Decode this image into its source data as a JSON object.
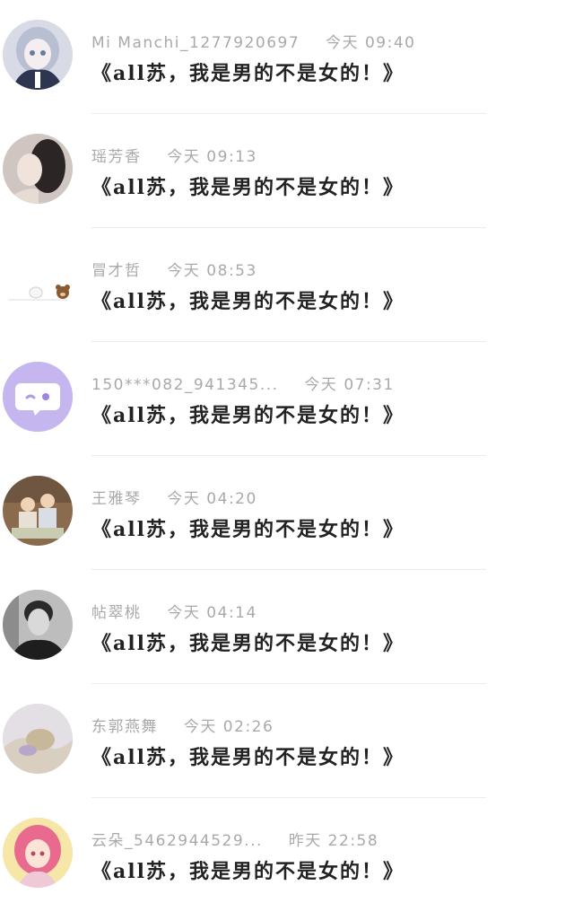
{
  "comments": [
    {
      "name": "Mi Manchi_1277920697",
      "time": "今天 09:40",
      "text": "《all苏，我是男的不是女的！》",
      "avatar_icon": "anime-girl-avatar",
      "avatar_colors": [
        "#d8dbe6",
        "#6b7aa0"
      ]
    },
    {
      "name": "瑶芳香",
      "time": "今天 09:13",
      "text": "《all苏，我是男的不是女的！》",
      "avatar_icon": "couple-photo-avatar",
      "avatar_colors": [
        "#cfc6c2",
        "#2b2526"
      ]
    },
    {
      "name": "冒才哲",
      "time": "今天 08:53",
      "text": "《all苏，我是男的不是女的！》",
      "avatar_icon": "cartoon-bear-avatar",
      "avatar_colors": [
        "#ffffff",
        "#8a5a33"
      ]
    },
    {
      "name": "150***082_941345...",
      "time": "今天 07:31",
      "text": "《all苏，我是男的不是女的！》",
      "avatar_icon": "chat-bubble-avatar",
      "avatar_colors": [
        "#c6b6f0",
        "#ffffff"
      ]
    },
    {
      "name": "王雅琴",
      "time": "今天 04:20",
      "text": "《all苏，我是男的不是女的！》",
      "avatar_icon": "kids-photo-avatar",
      "avatar_colors": [
        "#8a6b4e",
        "#e7e0d4"
      ]
    },
    {
      "name": "帖翠桃",
      "time": "今天 04:14",
      "text": "《all苏，我是男的不是女的！》",
      "avatar_icon": "man-portrait-avatar",
      "avatar_colors": [
        "#3a3a3a",
        "#d9d9d9"
      ]
    },
    {
      "name": "东郭燕舞",
      "time": "今天 02:26",
      "text": "《all苏，我是男的不是女的！》",
      "avatar_icon": "painting-avatar",
      "avatar_colors": [
        "#e3dfe4",
        "#c7b89a"
      ]
    },
    {
      "name": "云朵_5462944529...",
      "time": "昨天 22:58",
      "text": "《all苏，我是男的不是女的！》",
      "avatar_icon": "pink-hair-girl-avatar",
      "avatar_colors": [
        "#f6e7a8",
        "#e86a8e"
      ]
    }
  ]
}
